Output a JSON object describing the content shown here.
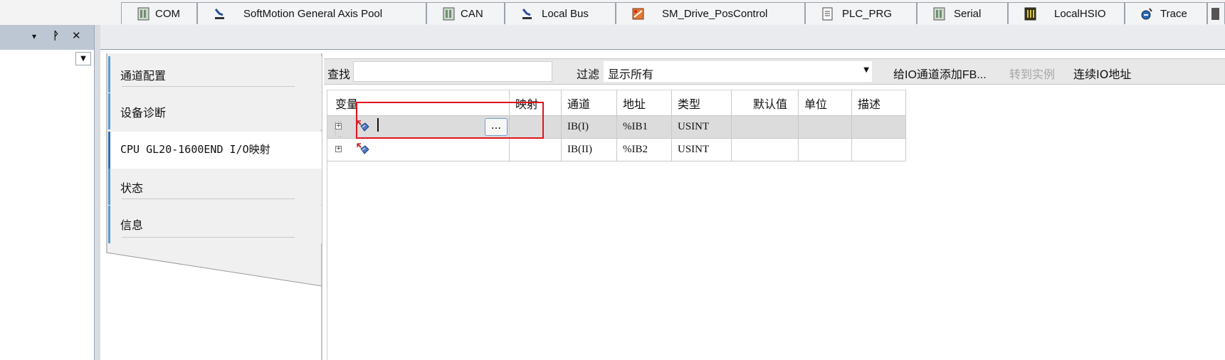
{
  "left_panel": {
    "controls": [
      "▾",
      "ᚹ",
      "✕"
    ]
  },
  "tabs": [
    {
      "label": "COM",
      "icon": "device-icon"
    },
    {
      "label": "SoftMotion General Axis Pool",
      "icon": "axis-icon"
    },
    {
      "label": "CAN",
      "icon": "device-icon"
    },
    {
      "label": "Local Bus",
      "icon": "axis-icon"
    },
    {
      "label": "SM_Drive_PosControl",
      "icon": "drive-icon"
    },
    {
      "label": "PLC_PRG",
      "icon": "program-icon"
    },
    {
      "label": "Serial",
      "icon": "device-icon"
    },
    {
      "label": "LocalHSIO",
      "icon": "hsio-icon"
    },
    {
      "label": "Trace",
      "icon": "trace-icon"
    }
  ],
  "nav": {
    "items": [
      {
        "label": "通道配置"
      },
      {
        "label": "设备诊断"
      },
      {
        "label": "CPU GL20-1600END I/O映射"
      },
      {
        "label": "状态"
      },
      {
        "label": "信息"
      }
    ]
  },
  "toolbar": {
    "find_label": "查找",
    "filter_label": "过滤",
    "filter_value": "显示所有",
    "add_fb": "给IO通道添加FB...",
    "goto_instance": "转到实例",
    "continuous_io": "连续IO地址"
  },
  "grid": {
    "columns": [
      "变量",
      "映射",
      "通道",
      "地址",
      "类型",
      "默认值",
      "单位",
      "描述"
    ],
    "rows": [
      {
        "variable": "",
        "mapping": "",
        "channel": "IB(I)",
        "address": "%IB1",
        "type": "USINT",
        "default": "",
        "unit": "",
        "description": ""
      },
      {
        "variable": "",
        "mapping": "",
        "channel": "IB(II)",
        "address": "%IB2",
        "type": "USINT",
        "default": "",
        "unit": "",
        "description": ""
      }
    ],
    "edit_button": "..."
  },
  "colors": {
    "highlight": "#e0141e",
    "nav_accent": "#5b9bd5",
    "panel_header": "#bdc7d4"
  }
}
